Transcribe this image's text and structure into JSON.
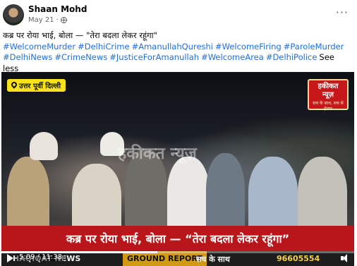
{
  "post": {
    "author": "Shaan Mohd",
    "date": "May 21",
    "date_separator": "·",
    "more_label": "···",
    "caption": "कब्र पर रोया भाई, बोला — \"तेरा बदला लेकर रहूंगा\"",
    "hashtags": [
      "#WelcomeMurder",
      "#DelhiCrime",
      "#AmanullahQureshi",
      "#WelcomeFiring",
      "#ParoleMurder",
      "#DelhiNews",
      "#CrimeNews",
      "#JusticeForAmanullah",
      "#WelcomeArea",
      "#DelhiPolice"
    ],
    "see_less": "See less"
  },
  "video": {
    "location_badge": "उत्तर पूर्वी दिल्ली",
    "logo_line1": "हकीकत",
    "logo_line2": "न्यूज़",
    "logo_tagline": "सच के साथ, सच से ईमान",
    "watermark": "हकीकत न्यूज़",
    "headline": "कब्र पर रोया भाई, बोला — “तेरा बदला लेकर रहूंगा”",
    "ticker": [
      "HAQIQAT NEWS",
      "GROUND REPORT",
      "सच के साथ",
      "96605554"
    ],
    "time_display": "5:09 / 11:38",
    "progress": 0.442
  },
  "colors": {
    "link": "#216fdb",
    "badge_yellow": "#f7e21b",
    "headline_red": "#b8161b"
  }
}
